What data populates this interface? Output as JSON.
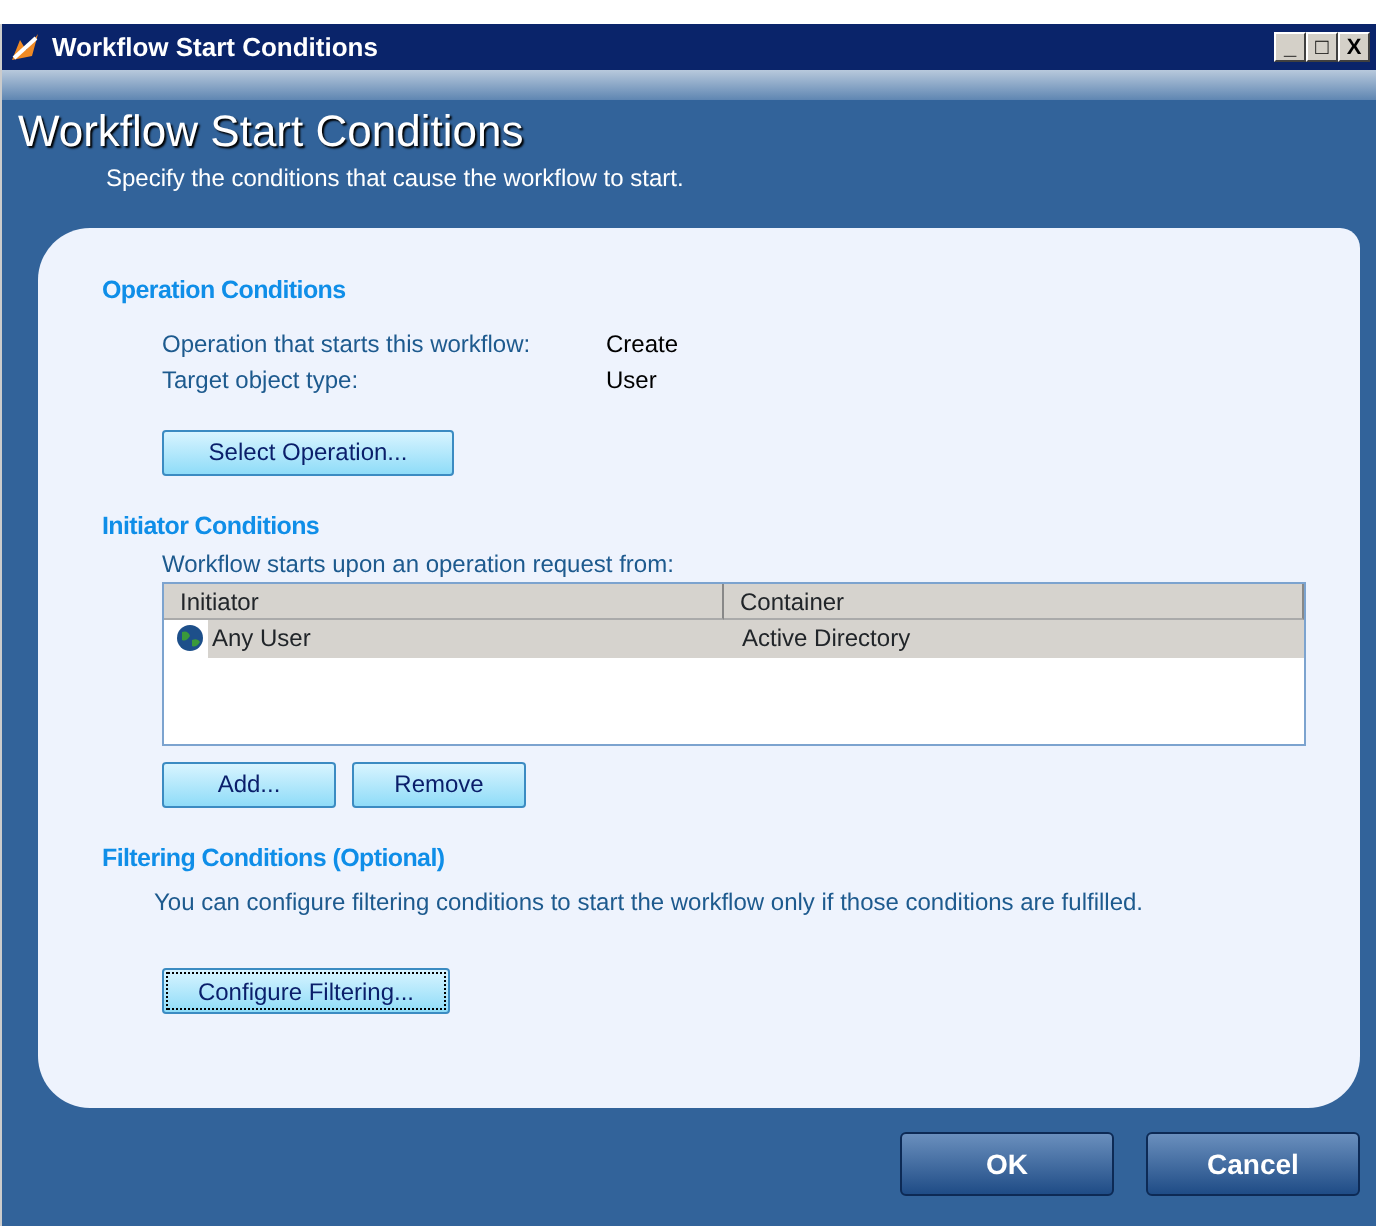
{
  "window": {
    "title": "Workflow Start Conditions",
    "controls": [
      "_",
      "□",
      "X"
    ]
  },
  "header": {
    "title": "Workflow Start Conditions",
    "subtitle": "Specify the conditions that cause the workflow to start."
  },
  "operation_conditions": {
    "heading": "Operation Conditions",
    "fields": [
      {
        "label": "Operation that starts this workflow:",
        "value": "Create"
      },
      {
        "label": "Target object type:",
        "value": "User"
      }
    ],
    "button": {
      "label": "Select Operation...",
      "focused": false
    }
  },
  "initiator_conditions": {
    "heading": "Initiator Conditions",
    "caption": "Workflow starts upon an operation request from:",
    "table": {
      "columns": [
        "Initiator",
        "Container"
      ],
      "rows": [
        {
          "cells": [
            "Any User",
            "Active Directory"
          ],
          "selected": true
        }
      ]
    },
    "buttons": [
      {
        "label": "Add...",
        "focused": false
      },
      {
        "label": "Remove",
        "focused": false
      }
    ]
  },
  "filtering_conditions": {
    "heading": "Filtering Conditions (Optional)",
    "description": "You can configure filtering conditions to start the workflow only if those conditions are fulfilled.",
    "button": {
      "label": "Configure Filtering...",
      "focused": true
    }
  },
  "buttons": [
    "OK",
    "Cancel"
  ]
}
